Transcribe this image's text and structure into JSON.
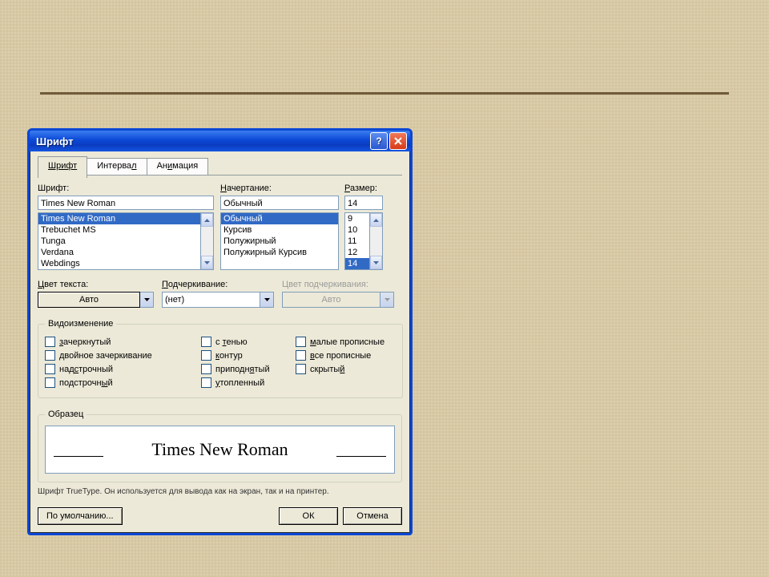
{
  "title": "Шрифт",
  "tabs": {
    "font": "Шрифт",
    "interval": "Интервал",
    "animation": "Анимация"
  },
  "labels": {
    "font": "Шрифт:",
    "style": "Начертание:",
    "size": "Размер:",
    "color": "Цвет текста:",
    "underline": "Подчеркивание:",
    "underlineColor": "Цвет подчеркивания:"
  },
  "fontField": "Times New Roman",
  "fontList": [
    "Times New Roman",
    "Trebuchet MS",
    "Tunga",
    "Verdana",
    "Webdings"
  ],
  "fontSelected": 0,
  "styleField": "Обычный",
  "styleList": [
    "Обычный",
    "Курсив",
    "Полужирный",
    "Полужирный Курсив"
  ],
  "styleSelected": 0,
  "sizeField": "14",
  "sizeList": [
    "9",
    "10",
    "11",
    "12",
    "14"
  ],
  "sizeSelected": 4,
  "colorValue": "Авто",
  "underlineValue": "(нет)",
  "underlineColorValue": "Авто",
  "effectsLegend": "Видоизменение",
  "effects": {
    "col1": [
      "зачеркнутый",
      "двойное зачеркивание",
      "надстрочный",
      "подстрочный"
    ],
    "col2": [
      "с тенью",
      "контур",
      "приподнятый",
      "утопленный"
    ],
    "col3": [
      "малые прописные",
      "все прописные",
      "скрытый"
    ]
  },
  "previewLegend": "Образец",
  "previewText": "Times New Roman",
  "hint": "Шрифт TrueType. Он используется для вывода как на экран, так и на принтер.",
  "buttons": {
    "default": "По умолчанию...",
    "ok": "ОК",
    "cancel": "Отмена"
  }
}
